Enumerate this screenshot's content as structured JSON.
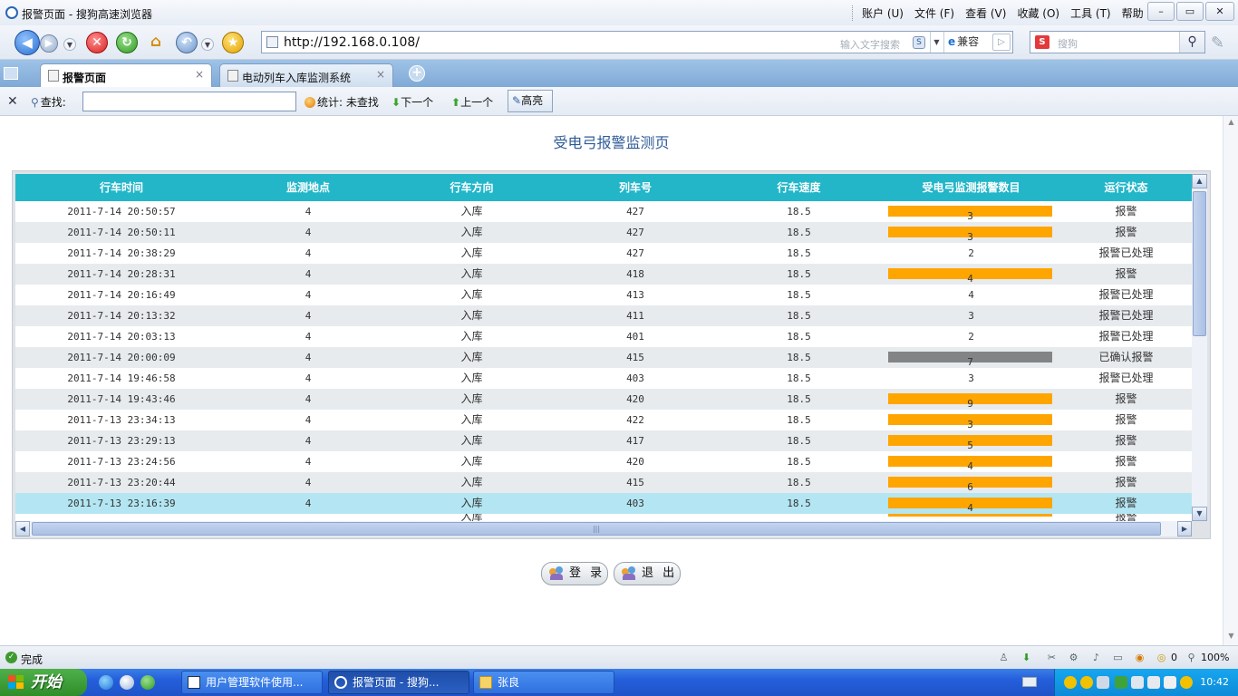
{
  "window": {
    "title": "报警页面 - 搜狗高速浏览器",
    "menu": [
      "账户 (U)",
      "文件 (F)",
      "查看 (V)",
      "收藏 (O)",
      "工具 (T)",
      "帮助 (H)"
    ],
    "controls": {
      "minimize": "–",
      "maximize": "▭",
      "close": "✕"
    }
  },
  "toolbar": {
    "url": "http://192.168.0.108/",
    "address_hint": "输入文字搜索",
    "compat_label": "兼容",
    "search_placeholder": "搜狗",
    "icons": {
      "back": "◀",
      "forward": "▶",
      "dropdown": "▼",
      "stop": "✕",
      "refresh": "↻",
      "home": "⌂",
      "undo": "↶",
      "favorite": "★",
      "go": "▷",
      "search": "⚲",
      "pen": "✎"
    }
  },
  "tabs": [
    {
      "label": "报警页面",
      "close": "×"
    },
    {
      "label": "电动列车入库监测系统",
      "close": "×"
    }
  ],
  "new_tab_icon": "+",
  "findbar": {
    "close": "✕",
    "find_label": "查找:",
    "stats": "统计: 未查找",
    "next": "下一个",
    "prev": "上一个",
    "highlight": "高亮",
    "icons": {
      "magnifier": "⚲",
      "down_arrow": "⬇",
      "up_arrow": "⬆",
      "pencil": "✎"
    }
  },
  "page": {
    "title": "受电弓报警监测页",
    "columns": [
      "行车时间",
      "监测地点",
      "行车方向",
      "列车号",
      "行车速度",
      "受电弓监测报警数目",
      "运行状态"
    ],
    "rows": [
      {
        "time": "2011-7-14 20:50:57",
        "site": "4",
        "direction": "入库",
        "train": "427",
        "speed": "18.5",
        "count": "3",
        "bar": "alarm",
        "status": "报警"
      },
      {
        "time": "2011-7-14 20:50:11",
        "site": "4",
        "direction": "入库",
        "train": "427",
        "speed": "18.5",
        "count": "3",
        "bar": "alarm",
        "status": "报警"
      },
      {
        "time": "2011-7-14 20:38:29",
        "site": "4",
        "direction": "入库",
        "train": "427",
        "speed": "18.5",
        "count": "2",
        "bar": "none",
        "status": "报警已处理"
      },
      {
        "time": "2011-7-14 20:28:31",
        "site": "4",
        "direction": "入库",
        "train": "418",
        "speed": "18.5",
        "count": "4",
        "bar": "alarm",
        "status": "报警"
      },
      {
        "time": "2011-7-14 20:16:49",
        "site": "4",
        "direction": "入库",
        "train": "413",
        "speed": "18.5",
        "count": "4",
        "bar": "none",
        "status": "报警已处理"
      },
      {
        "time": "2011-7-14 20:13:32",
        "site": "4",
        "direction": "入库",
        "train": "411",
        "speed": "18.5",
        "count": "3",
        "bar": "none",
        "status": "报警已处理"
      },
      {
        "time": "2011-7-14 20:03:13",
        "site": "4",
        "direction": "入库",
        "train": "401",
        "speed": "18.5",
        "count": "2",
        "bar": "none",
        "status": "报警已处理"
      },
      {
        "time": "2011-7-14 20:00:09",
        "site": "4",
        "direction": "入库",
        "train": "415",
        "speed": "18.5",
        "count": "7",
        "bar": "confirmed",
        "status": "已确认报警"
      },
      {
        "time": "2011-7-14 19:46:58",
        "site": "4",
        "direction": "入库",
        "train": "403",
        "speed": "18.5",
        "count": "3",
        "bar": "none",
        "status": "报警已处理"
      },
      {
        "time": "2011-7-14 19:43:46",
        "site": "4",
        "direction": "入库",
        "train": "420",
        "speed": "18.5",
        "count": "9",
        "bar": "alarm",
        "status": "报警"
      },
      {
        "time": "2011-7-13 23:34:13",
        "site": "4",
        "direction": "入库",
        "train": "422",
        "speed": "18.5",
        "count": "3",
        "bar": "alarm",
        "status": "报警"
      },
      {
        "time": "2011-7-13 23:29:13",
        "site": "4",
        "direction": "入库",
        "train": "417",
        "speed": "18.5",
        "count": "5",
        "bar": "alarm",
        "status": "报警"
      },
      {
        "time": "2011-7-13 23:24:56",
        "site": "4",
        "direction": "入库",
        "train": "420",
        "speed": "18.5",
        "count": "4",
        "bar": "alarm",
        "status": "报警"
      },
      {
        "time": "2011-7-13 23:20:44",
        "site": "4",
        "direction": "入库",
        "train": "415",
        "speed": "18.5",
        "count": "6",
        "bar": "alarm",
        "status": "报警"
      },
      {
        "time": "2011-7-13 23:16:39",
        "site": "4",
        "direction": "入库",
        "train": "403",
        "speed": "18.5",
        "count": "4",
        "bar": "alarm",
        "status": "报警",
        "selected": true
      }
    ],
    "partial_row": {
      "direction": "入库",
      "status": "报警",
      "bar": "alarm"
    },
    "scroll_icons": {
      "up": "▲",
      "down": "▼",
      "left": "◀",
      "right": "▶",
      "grip": "|||",
      "grip_v": "≡"
    },
    "buttons": {
      "login": "登 录",
      "logout": "退 出"
    }
  },
  "statusbar": {
    "text": "完成",
    "check_icon": "✓",
    "download_count": "0",
    "zoom": "100%"
  },
  "taskbar": {
    "start": "开始",
    "tasks": [
      {
        "label": "用户管理软件使用...",
        "icon": "word-doc-icon"
      },
      {
        "label": "报警页面 - 搜狗...",
        "icon": "sogou-browser-icon",
        "active": true
      },
      {
        "label": "张良",
        "icon": "folder-icon"
      }
    ],
    "clock": "10:42"
  },
  "colors": {
    "grid_header": "#23b6c9",
    "alarm_bar": "#ffa500",
    "confirmed_bar": "#838486",
    "row_alt": "#e7ebee",
    "row_selected": "#b3e6f2",
    "page_title": "#2f5b96"
  }
}
